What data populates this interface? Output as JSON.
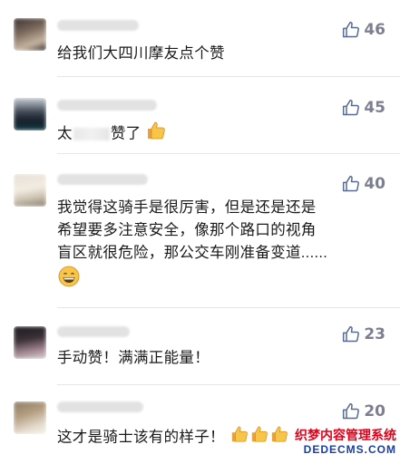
{
  "comments": [
    {
      "likes": "46",
      "text_parts": [
        "给我们大四川摩友点个赞"
      ]
    },
    {
      "likes": "45",
      "text_parts": [
        "太",
        "赞了"
      ]
    },
    {
      "likes": "40",
      "lines": [
        "我觉得这骑手是很厉害，但是还是还是",
        "希望要多注意安全，像那个路口的视角",
        "盲区就很危险，那公交车刚准备变道......"
      ]
    },
    {
      "likes": "23",
      "text_parts": [
        "手动赞！满满正能量！"
      ]
    },
    {
      "likes": "20",
      "text_parts": [
        "这才是骑士该有的样子！"
      ]
    }
  ],
  "watermark": {
    "cn": "织梦内容管理系统",
    "en": "DEDECMS.COM"
  },
  "colors": {
    "like_icon": "#576b95",
    "like_count": "#7b7f8f",
    "text": "#1a1a1a"
  },
  "icons": {
    "like": "thumbs-up-outline-icon",
    "emoji_thumb": "thumbs-up-emoji-icon",
    "emoji_grin": "grinning-emoji-icon"
  }
}
